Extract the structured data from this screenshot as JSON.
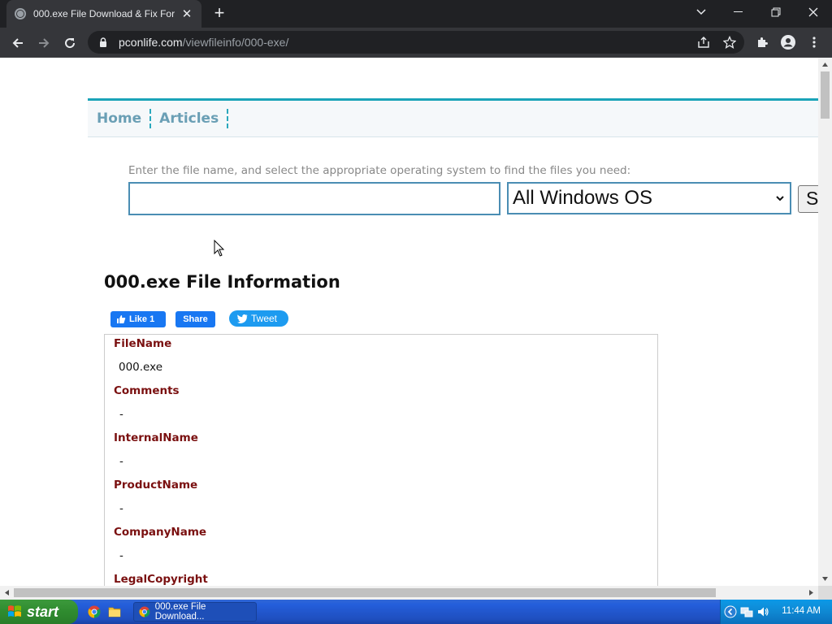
{
  "browser": {
    "tab_title": "000.exe File Download & Fix For",
    "url_host": "pconlife.com",
    "url_path": "/viewfileinfo/000-exe/"
  },
  "nav": {
    "items": [
      {
        "label": "Home"
      },
      {
        "label": "Articles"
      }
    ]
  },
  "search": {
    "hint": "Enter the file name, and select the appropriate operating system to find the files you need:",
    "input_value": "",
    "os_selected": "All Windows OS",
    "button_label": "S"
  },
  "page": {
    "title": "000.exe File Information"
  },
  "social": {
    "like_label": "Like 1",
    "share_label": "Share",
    "tweet_label": "Tweet"
  },
  "fields": [
    {
      "label": "FileName",
      "value": "000.exe"
    },
    {
      "label": "Comments",
      "value": "-"
    },
    {
      "label": "InternalName",
      "value": "-"
    },
    {
      "label": "ProductName",
      "value": "-"
    },
    {
      "label": "CompanyName",
      "value": "-"
    },
    {
      "label": "LegalCopyright",
      "value": ""
    }
  ],
  "taskbar": {
    "start_label": "start",
    "task_label": "000.exe File Download...",
    "clock": "11:44 AM"
  },
  "colors": {
    "nav_accent": "#1aa3b8",
    "field_label": "#7a1010",
    "input_border": "#4a8db3"
  }
}
